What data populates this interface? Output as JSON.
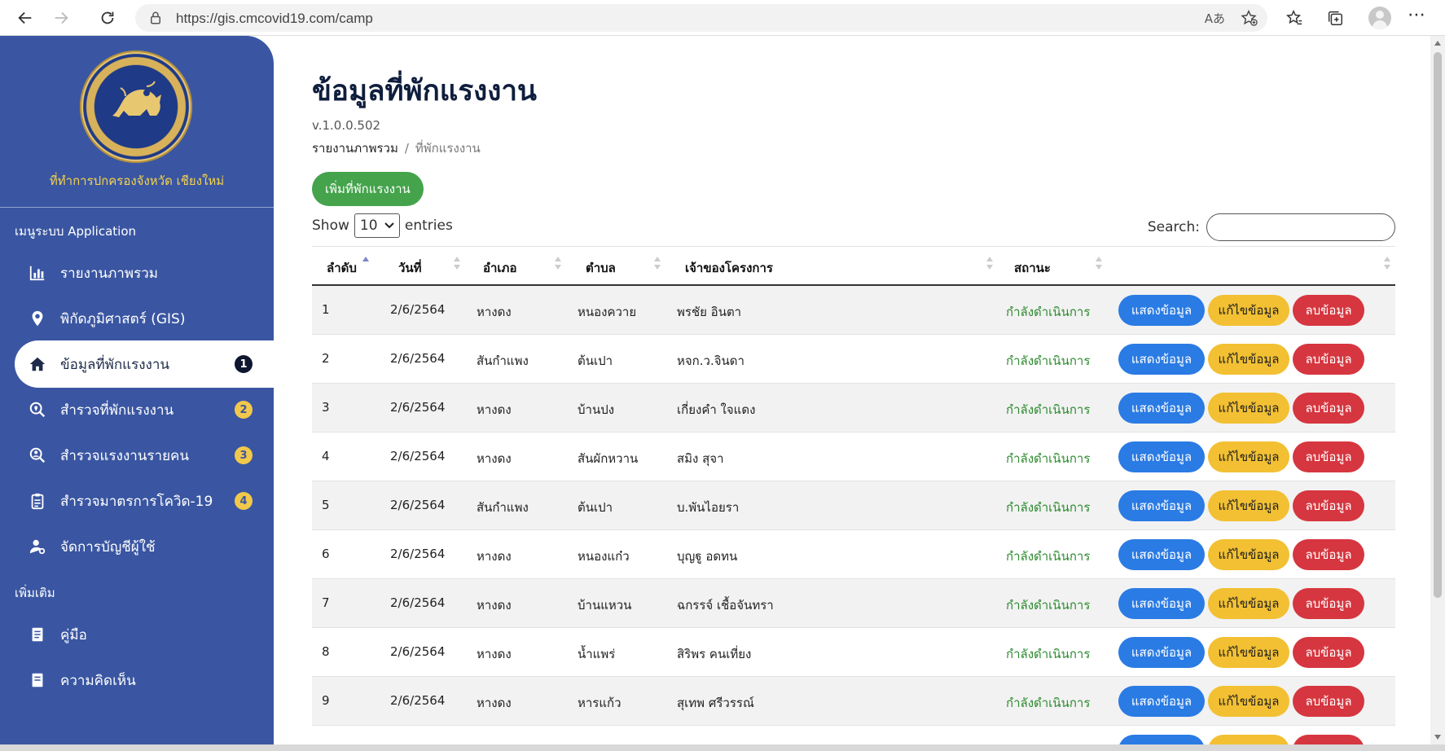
{
  "browser": {
    "url": "https://gis.cmcovid19.com/camp",
    "read_aloud": "Aあ"
  },
  "sidebar": {
    "org_name": "ที่ทำการปกครองจังหวัด เชียงใหม่",
    "section_app": "เมนูระบบ Application",
    "section_more": "เพิ่มเติม",
    "items": [
      {
        "label": "รายงานภาพรวม",
        "icon": "chart-icon"
      },
      {
        "label": "พิกัดภูมิศาสตร์ (GIS)",
        "icon": "map-pin-icon"
      },
      {
        "label": "ข้อมูลที่พักแรงงาน",
        "icon": "home-icon",
        "badge": "1",
        "active": true
      },
      {
        "label": "สำรวจที่พักแรงงาน",
        "icon": "search-location-icon",
        "badge": "2"
      },
      {
        "label": "สำรวจแรงงานรายคน",
        "icon": "search-user-icon",
        "badge": "3"
      },
      {
        "label": "สำรวจมาตรการโควิด-19",
        "icon": "clipboard-icon",
        "badge": "4"
      },
      {
        "label": "จัดการบัญชีผู้ใช้",
        "icon": "user-cog-icon"
      }
    ],
    "more_items": [
      {
        "label": "คู่มือ",
        "icon": "book-icon"
      },
      {
        "label": "ความคิดเห็น",
        "icon": "comment-icon"
      }
    ]
  },
  "main": {
    "title": "ข้อมูลที่พักแรงงาน",
    "version": "v.1.0.0.502",
    "breadcrumb": [
      "รายงานภาพรวม",
      "ที่พักแรงงาน"
    ],
    "breadcrumb_sep": "/",
    "add_button": "เพิ่มที่พักแรงงาน",
    "show_label": "Show",
    "entries_value": "10",
    "entries_label": "entries",
    "search_label": "Search:",
    "search_value": "",
    "columns": [
      "ลำดับ",
      "วันที่",
      "อำเภอ",
      "ตำบล",
      "เจ้าของโครงการ",
      "สถานะ",
      ""
    ],
    "actions": {
      "view": "แสดงข้อมูล",
      "edit": "แก้ไขข้อมูล",
      "delete": "ลบข้อมูล"
    },
    "rows": [
      {
        "no": "1",
        "date": "2/6/2564",
        "amphoe": "หางดง",
        "tambon": "หนองควาย",
        "owner": "พรชัย อินตา",
        "status": "กำลังดำเนินการ"
      },
      {
        "no": "2",
        "date": "2/6/2564",
        "amphoe": "สันกำแพง",
        "tambon": "ต้นเปา",
        "owner": "หจก.ว.จินดา",
        "status": "กำลังดำเนินการ"
      },
      {
        "no": "3",
        "date": "2/6/2564",
        "amphoe": "หางดง",
        "tambon": "บ้านปง",
        "owner": "เกี่ยงคำ ใจแดง",
        "status": "กำลังดำเนินการ"
      },
      {
        "no": "4",
        "date": "2/6/2564",
        "amphoe": "หางดง",
        "tambon": "สันผักหวาน",
        "owner": "สมิง สุจา",
        "status": "กำลังดำเนินการ"
      },
      {
        "no": "5",
        "date": "2/6/2564",
        "amphoe": "สันกำแพง",
        "tambon": "ต้นเปา",
        "owner": "บ.พันไอยรา",
        "status": "กำลังดำเนินการ"
      },
      {
        "no": "6",
        "date": "2/6/2564",
        "amphoe": "หางดง",
        "tambon": "หนองแก๋ว",
        "owner": "บุญฐู อดทน",
        "status": "กำลังดำเนินการ"
      },
      {
        "no": "7",
        "date": "2/6/2564",
        "amphoe": "หางดง",
        "tambon": "บ้านแหวน",
        "owner": "ฉกรรจ์ เชื้อจันทรา",
        "status": "กำลังดำเนินการ"
      },
      {
        "no": "8",
        "date": "2/6/2564",
        "amphoe": "หางดง",
        "tambon": "น้ำแพร่",
        "owner": "สิริพร คนเที่ยง",
        "status": "กำลังดำเนินการ"
      },
      {
        "no": "9",
        "date": "2/6/2564",
        "amphoe": "หางดง",
        "tambon": "หารแก้ว",
        "owner": "สุเทพ ศรีวรรณ์",
        "status": "กำลังดำเนินการ"
      }
    ]
  },
  "colors": {
    "sidebar": "#3a56a2",
    "add": "#44a34b",
    "view": "#2a7be4",
    "edit": "#f2c032",
    "delete": "#d6363f",
    "status": "#2c8a2e"
  }
}
